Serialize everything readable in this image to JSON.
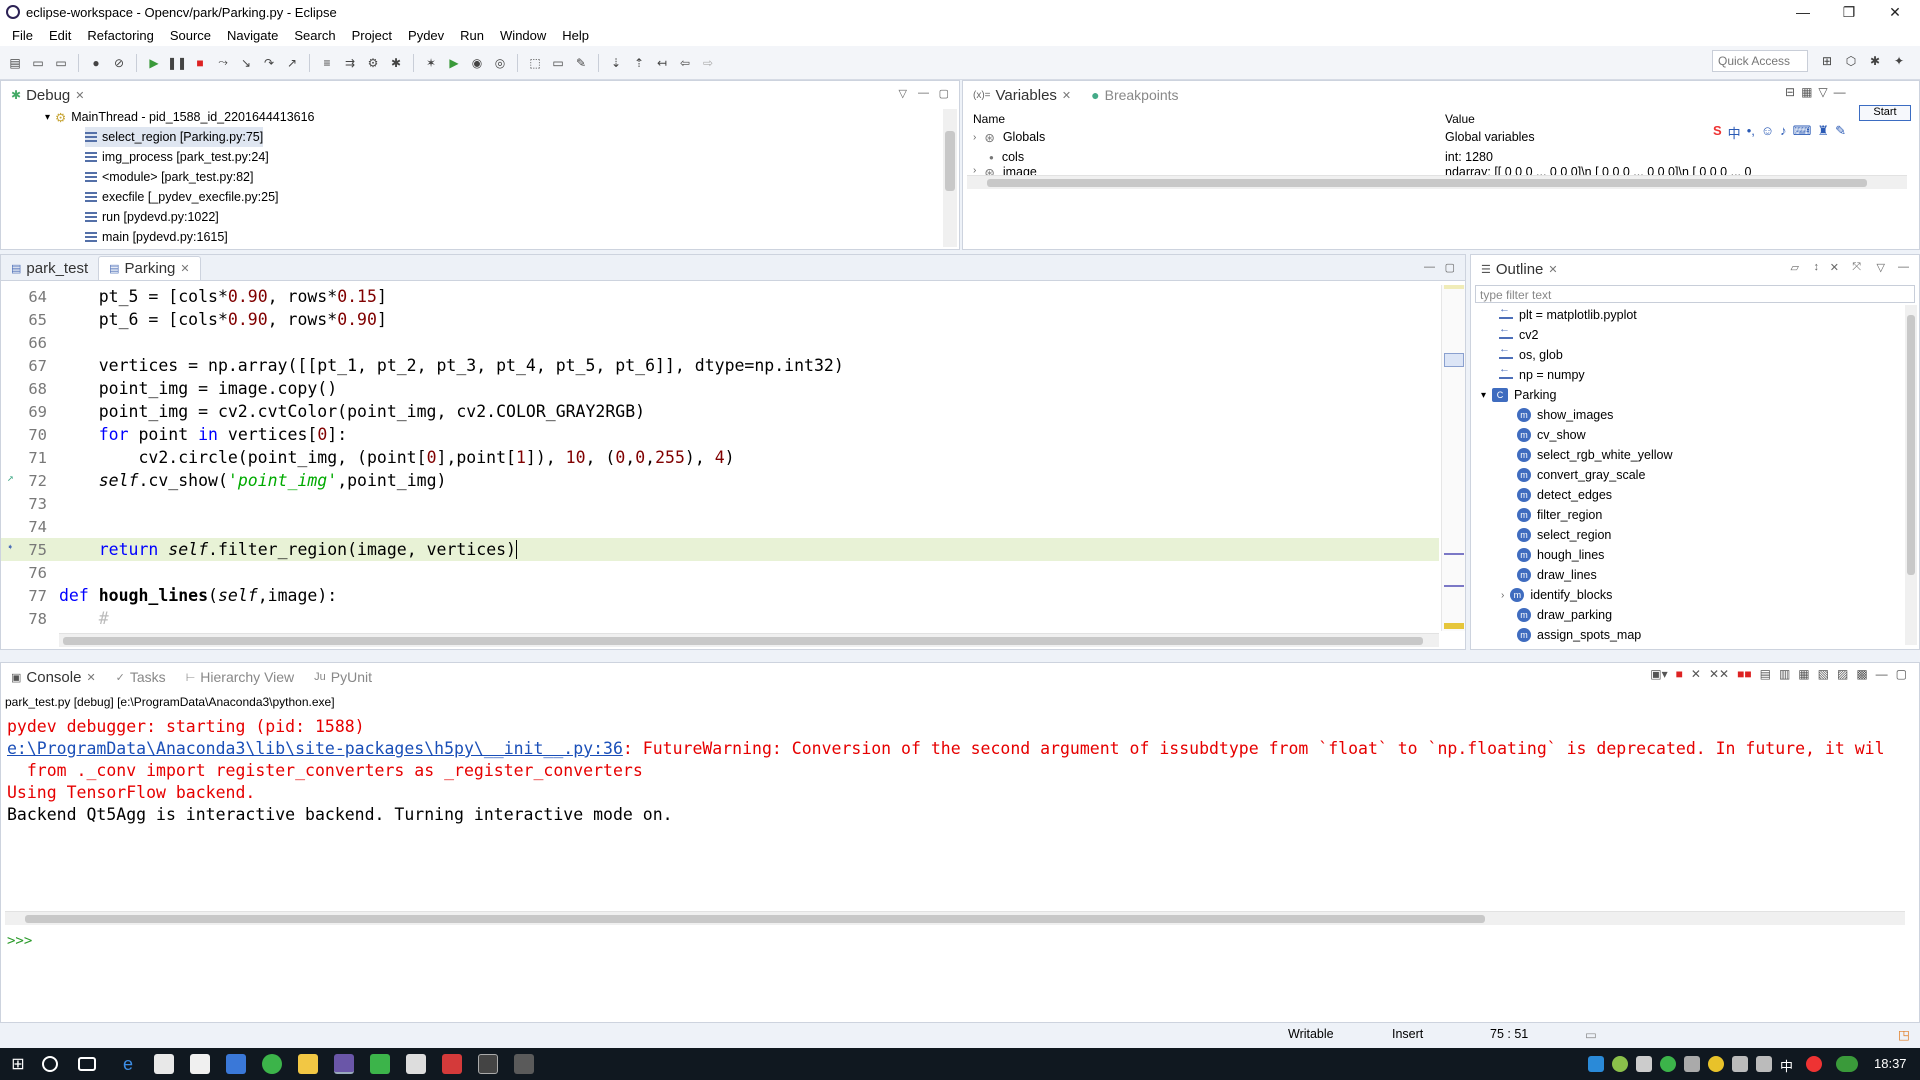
{
  "window": {
    "title": "eclipse-workspace - Opencv/park/Parking.py - Eclipse",
    "minimize": "—",
    "maximize": "❐",
    "close": "✕"
  },
  "menu": [
    "File",
    "Edit",
    "Refactoring",
    "Source",
    "Navigate",
    "Search",
    "Project",
    "Pydev",
    "Run",
    "Window",
    "Help"
  ],
  "quick_access": "Quick Access",
  "debug_view": {
    "tab": "Debug",
    "thread": "MainThread - pid_1588_id_2201644413616",
    "frames": [
      "select_region [Parking.py:75]",
      "img_process [park_test.py:24]",
      "<module> [park_test.py:82]",
      "execfile [_pydev_execfile.py:25]",
      "run [pydevd.py:1022]",
      "main [pydevd.py:1615]"
    ]
  },
  "variables_view": {
    "tab": "Variables",
    "tab2": "Breakpoints",
    "col_name": "Name",
    "col_value": "Value",
    "start": "Start",
    "rows": [
      {
        "name": "Globals",
        "value": "Global variables"
      },
      {
        "name": "cols",
        "value": "int: 1280"
      },
      {
        "name": "image",
        "value": "ndarray: [[ 0  0  0 ...  0  0  0]\\n [ 0  0  0 ...  0  0  0]\\n [ 0  0  0 ...  0"
      }
    ]
  },
  "editor": {
    "tabs": [
      "park_test",
      "Parking"
    ],
    "line_numbers": [
      "64",
      "65",
      "66",
      "67",
      "68",
      "69",
      "70",
      "71",
      "72",
      "73",
      "74",
      "75",
      "76",
      "77",
      "78"
    ]
  },
  "outline": {
    "tab": "Outline",
    "filter_placeholder": "type filter text",
    "imports": [
      "plt = matplotlib.pyplot",
      "cv2",
      "os, glob",
      "np = numpy"
    ],
    "class_name": "Parking",
    "methods": [
      "show_images",
      "cv_show",
      "select_rgb_white_yellow",
      "convert_gray_scale",
      "detect_edges",
      "filter_region",
      "select_region",
      "hough_lines",
      "draw_lines",
      "identify_blocks",
      "draw_parking",
      "assign_spots_map"
    ]
  },
  "console": {
    "tabs": [
      "Console",
      "Tasks",
      "Hierarchy View",
      "PyUnit"
    ],
    "process": "park_test.py [debug] [e:\\ProgramData\\Anaconda3\\python.exe]",
    "line1": "pydev debugger: starting (pid: 1588)",
    "warn_link": "e:\\ProgramData\\Anaconda3\\lib\\site-packages\\h5py\\__init__.py:36",
    "warn_text": ": FutureWarning: Conversion of the second argument of issubdtype from `float` to `np.floating` is deprecated. In future, it wil",
    "line3": "  from ._conv import register_converters as _register_converters",
    "line4": "Using TensorFlow backend.",
    "line5": "Backend Qt5Agg is interactive backend. Turning interactive mode on.",
    "prompt": ">>>"
  },
  "status": {
    "writable": "Writable",
    "insert": "Insert",
    "position": "75 : 51"
  },
  "taskbar": {
    "time": "18:37",
    "ime": "中"
  },
  "colors": {
    "keyword": "#0000ff",
    "string": "#00aa00",
    "number": "#800000",
    "error": "#e60000",
    "link": "#1a4fb8"
  }
}
